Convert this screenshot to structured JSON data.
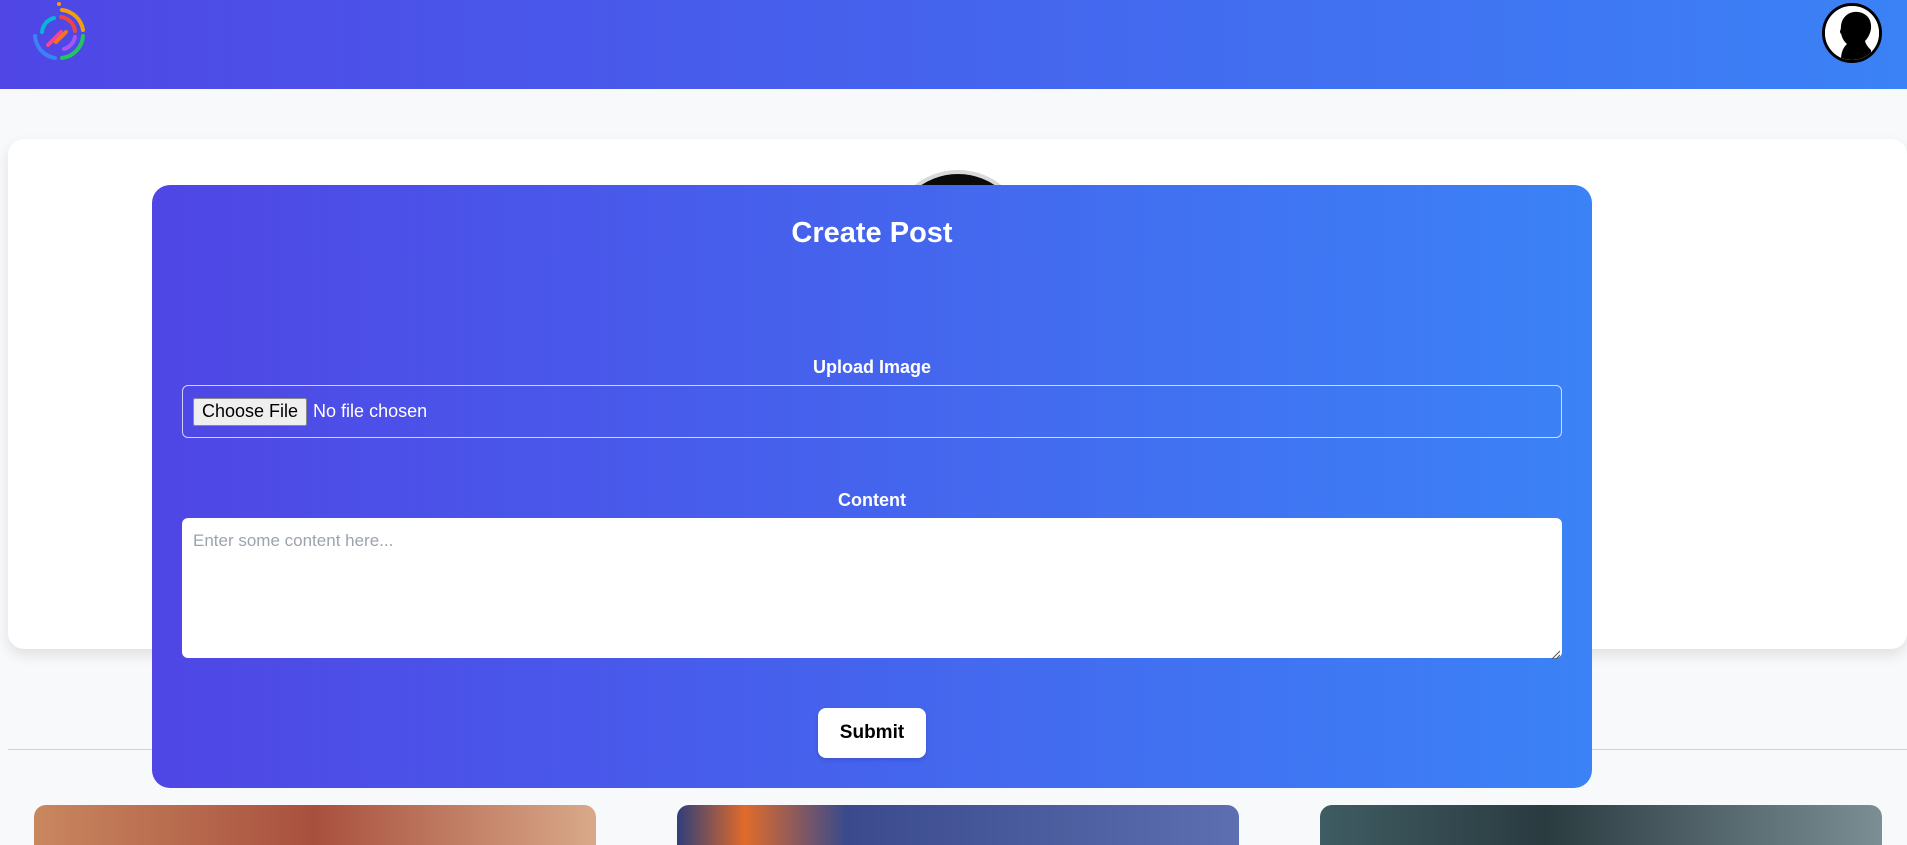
{
  "header": {
    "logo_icon": "spiral-logo-icon",
    "avatar_icon": "profile-silhouette-icon"
  },
  "modal": {
    "title": "Create Post",
    "upload_label": "Upload Image",
    "file_button_label": "Choose File",
    "file_status": "No file chosen",
    "content_label": "Content",
    "content_placeholder": "Enter some content here...",
    "content_value": "",
    "submit_label": "Submit"
  },
  "colors": {
    "gradient_start": "#4f46e5",
    "gradient_end": "#3b82f6",
    "page_background": "#f8f9fb"
  }
}
